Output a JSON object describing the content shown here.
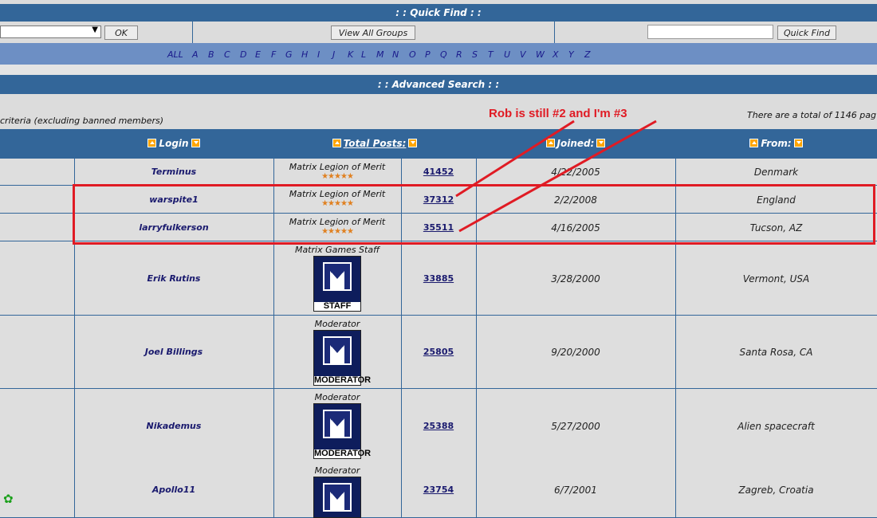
{
  "quick_find": {
    "title": ": : Quick Find : :",
    "ok_label": "OK",
    "view_all_groups_label": "View All Groups",
    "quick_find_label": "Quick Find",
    "search_value": ""
  },
  "alphabet": [
    "ALL",
    "A",
    "B",
    "C",
    "D",
    "E",
    "F",
    "G",
    "H",
    "I",
    "J",
    "K",
    "L",
    "M",
    "N",
    "O",
    "P",
    "Q",
    "R",
    "S",
    "T",
    "U",
    "V",
    "W",
    "X",
    "Y",
    "Z"
  ],
  "advanced_search": {
    "title": ": : Advanced Search : :"
  },
  "criteria_text": "criteria (excluding banned members)",
  "total_text": "There are a total of 1146 pag",
  "annotation": "Rob is still #2 and I'm #3",
  "headers": {
    "login": "Login",
    "total_posts": "Total Posts:",
    "joined": "Joined:",
    "from": "From:"
  },
  "members": [
    {
      "login": "Terminus",
      "rank": "Matrix Legion of Merit",
      "stars": "★★★★★",
      "posts": "41452",
      "joined": "4/22/2005",
      "from": "Denmark"
    },
    {
      "login": "warspite1",
      "rank": "Matrix Legion of Merit",
      "stars": "★★★★★",
      "posts": "37312",
      "joined": "2/2/2008",
      "from": "England"
    },
    {
      "login": "larryfulkerson",
      "rank": "Matrix Legion of Merit",
      "stars": "★★★★★",
      "posts": "35511",
      "joined": "4/16/2005",
      "from": "Tucson, AZ"
    },
    {
      "login": "Erik Rutins",
      "rank": "Matrix Games Staff",
      "badge": "STAFF",
      "posts": "33885",
      "joined": "3/28/2000",
      "from": "Vermont, USA"
    },
    {
      "login": "Joel Billings",
      "rank": "Moderator",
      "badge": "MODERATOR",
      "posts": "25805",
      "joined": "9/20/2000",
      "from": "Santa Rosa, CA"
    },
    {
      "login": "Nikademus",
      "rank": "Moderator",
      "badge": "MODERATOR",
      "posts": "25388",
      "joined": "5/27/2000",
      "from": "Alien spacecraft"
    },
    {
      "login": "Apollo11",
      "rank": "Moderator",
      "posts": "23754",
      "joined": "6/7/2001",
      "from": "Zagreb, Croatia"
    }
  ],
  "colors": {
    "header_blue": "#336699",
    "alpha_bar": "#6d8fc4",
    "annotation_red": "#e01b24",
    "row_bg": "#dedede"
  }
}
